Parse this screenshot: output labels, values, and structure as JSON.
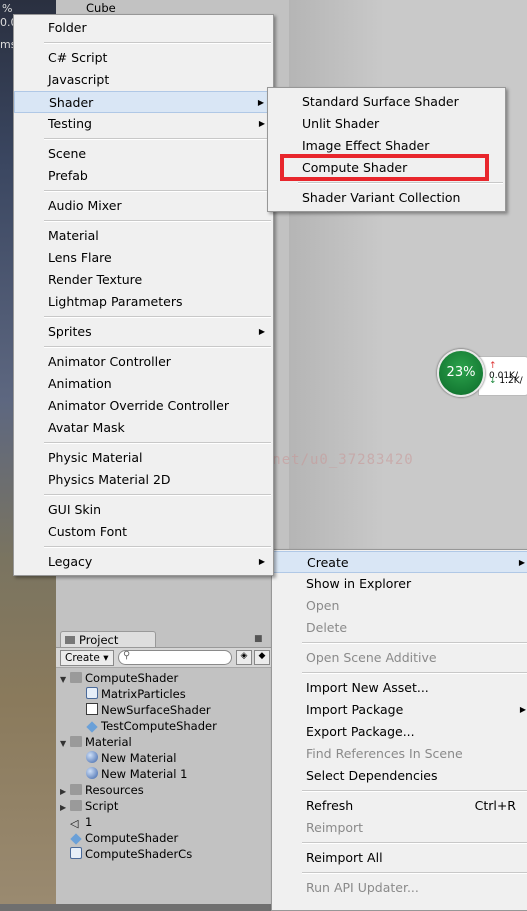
{
  "hierarchy": {
    "top_item": "Cube"
  },
  "left_strip": {
    "text1": "%",
    "text2": "0.0",
    "text3": "ms"
  },
  "create_menu": {
    "items": [
      {
        "label": "Folder"
      },
      {
        "label": "C# Script"
      },
      {
        "label": "Javascript"
      },
      {
        "label": "Shader",
        "has_submenu": true,
        "highlighted": true
      },
      {
        "label": "Testing",
        "has_submenu": true
      },
      {
        "label": "Scene"
      },
      {
        "label": "Prefab"
      },
      {
        "label": "Audio Mixer"
      },
      {
        "label": "Material"
      },
      {
        "label": "Lens Flare"
      },
      {
        "label": "Render Texture"
      },
      {
        "label": "Lightmap Parameters"
      },
      {
        "label": "Sprites",
        "has_submenu": true
      },
      {
        "label": "Animator Controller"
      },
      {
        "label": "Animation"
      },
      {
        "label": "Animator Override Controller"
      },
      {
        "label": "Avatar Mask"
      },
      {
        "label": "Physic Material"
      },
      {
        "label": "Physics Material 2D"
      },
      {
        "label": "GUI Skin"
      },
      {
        "label": "Custom Font"
      },
      {
        "label": "Legacy",
        "has_submenu": true
      }
    ]
  },
  "shader_submenu": {
    "items": [
      {
        "label": "Standard Surface Shader"
      },
      {
        "label": "Unlit Shader"
      },
      {
        "label": "Image Effect Shader"
      },
      {
        "label": "Compute Shader",
        "outlined": true
      },
      {
        "label": "Shader Variant Collection"
      }
    ]
  },
  "context_menu": {
    "items": [
      {
        "label": "Create",
        "highlighted": true
      },
      {
        "label": "Show in Explorer"
      },
      {
        "label": "Open",
        "disabled": true
      },
      {
        "label": "Delete",
        "disabled": true
      },
      {
        "label": "Open Scene Additive",
        "disabled": true
      },
      {
        "label": "Import New Asset..."
      },
      {
        "label": "Import Package"
      },
      {
        "label": "Export Package..."
      },
      {
        "label": "Find References In Scene",
        "disabled": true
      },
      {
        "label": "Select Dependencies"
      },
      {
        "label": "Refresh",
        "shortcut": "Ctrl+R"
      },
      {
        "label": "Reimport",
        "disabled": true
      },
      {
        "label": "Reimport All"
      },
      {
        "label": "Run API Updater...",
        "disabled": true
      }
    ]
  },
  "stats": {
    "percent": "23%",
    "up": "0.01K/",
    "down": "1.2K/"
  },
  "project": {
    "tab_label": "Project",
    "create_label": "Create",
    "search_placeholder": "",
    "tree": [
      {
        "label": "ComputeShader",
        "type": "folder",
        "level": 0
      },
      {
        "label": "MatrixParticles",
        "type": "cs",
        "level": 1
      },
      {
        "label": "NewSurfaceShader",
        "type": "shader",
        "level": 1
      },
      {
        "label": "TestComputeShader",
        "type": "compute",
        "level": 1
      },
      {
        "label": "Material",
        "type": "folder",
        "level": 0
      },
      {
        "label": "New Material",
        "type": "material",
        "level": 1
      },
      {
        "label": "New Material 1",
        "type": "material",
        "level": 1
      },
      {
        "label": "Resources",
        "type": "folder",
        "level": 0
      },
      {
        "label": "Script",
        "type": "folder",
        "level": 0
      },
      {
        "label": "1",
        "type": "unity",
        "level": 0
      },
      {
        "label": "ComputeShader",
        "type": "compute",
        "level": 0
      },
      {
        "label": "ComputeShaderCs",
        "type": "cs",
        "level": 0
      }
    ]
  },
  "watermark": "http://blog.csdn.net/u0_37283420",
  "colors": {
    "highlight": "#d9e6f5",
    "outline": "#e8262c",
    "stats_green": "#1e8a3e"
  }
}
